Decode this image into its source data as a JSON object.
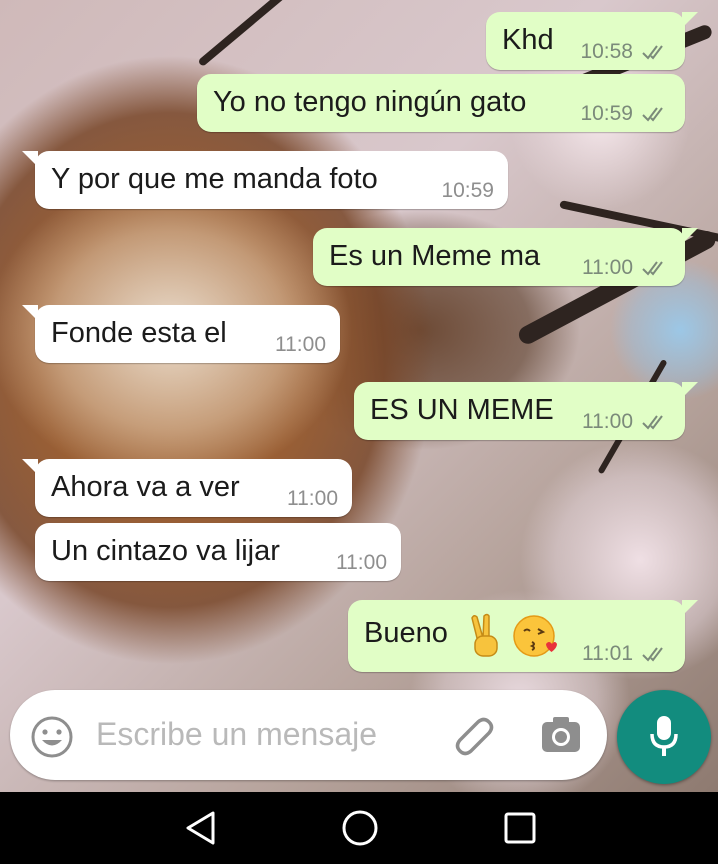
{
  "messages": [
    {
      "side": "out",
      "text": "Khd",
      "time": "10:58",
      "tail": true
    },
    {
      "side": "out",
      "text": "Yo no tengo ningún gato",
      "time": "10:59",
      "tail": false
    },
    {
      "side": "in",
      "text": "Y por que me manda foto",
      "time": "10:59",
      "tail": true
    },
    {
      "side": "out",
      "text": "Es un Meme ma",
      "time": "11:00",
      "tail": true
    },
    {
      "side": "in",
      "text": "Fonde esta el",
      "time": "11:00",
      "tail": true
    },
    {
      "side": "out",
      "text": "ES UN MEME",
      "time": "11:00",
      "tail": true
    },
    {
      "side": "in",
      "text": "Ahora va a ver",
      "time": "11:00",
      "tail": true
    },
    {
      "side": "in",
      "text": "Un cintazo va lijar",
      "time": "11:00",
      "tail": false
    },
    {
      "side": "out",
      "text": "Bueno",
      "time": "11:01",
      "tail": true,
      "emoji": [
        "victory-hand-emoji",
        "kissing-heart-emoji"
      ]
    }
  ],
  "composer": {
    "placeholder": "Escribe un mensaje"
  },
  "icons": {
    "emoji": "smiley-icon",
    "attach": "paperclip-icon",
    "camera": "camera-icon",
    "mic": "microphone-icon",
    "back": "back-triangle-icon",
    "home": "home-circle-icon",
    "recents": "recents-square-icon"
  },
  "colors": {
    "outgoing": "#e1fec6",
    "incoming": "#ffffff",
    "accent": "#128c7e",
    "read_ticks": "#7b8a7a"
  }
}
